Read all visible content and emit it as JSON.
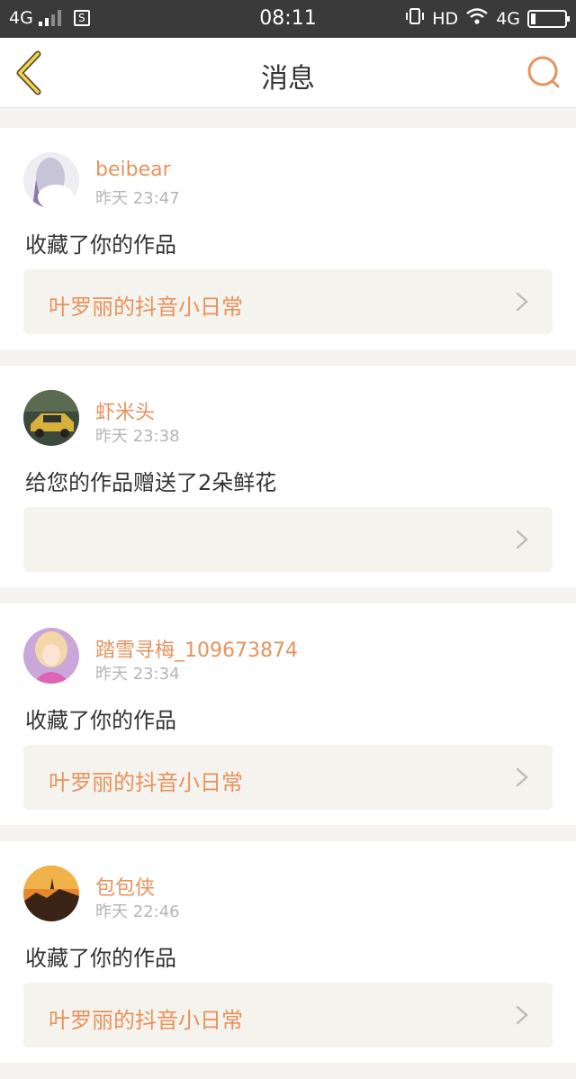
{
  "status_bar": {
    "network_left": "4G",
    "time": "08:11",
    "hd": "HD",
    "network_right": "4G",
    "sim_label": "S"
  },
  "header": {
    "title": "消息",
    "back_icon": "chevron-left-icon",
    "search_icon": "search-icon"
  },
  "colors": {
    "accent": "#e8925c",
    "link_bg": "#f4f3ed",
    "page_bg": "#f5f4f2"
  },
  "notifications": [
    {
      "username": "beibear",
      "time": "昨天 23:47",
      "message": "收藏了你的作品",
      "work_title": "叶罗丽的抖音小日常"
    },
    {
      "username": "虾米头",
      "time": "昨天 23:38",
      "message": "给您的作品赠送了2朵鲜花",
      "work_title": ""
    },
    {
      "username": "踏雪寻梅_109673874",
      "time": "昨天 23:34",
      "message": "收藏了你的作品",
      "work_title": "叶罗丽的抖音小日常"
    },
    {
      "username": "包包侠",
      "time": "昨天 22:46",
      "message": "收藏了你的作品",
      "work_title": "叶罗丽的抖音小日常"
    }
  ]
}
